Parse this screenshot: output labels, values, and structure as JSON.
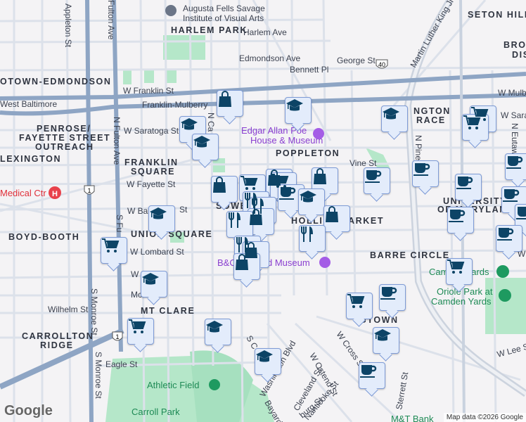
{
  "map": {
    "attribution": "Map data ©2026 Google",
    "logo": "Google",
    "neighborhoods": [
      "HARLEM PARK",
      "SETON HILL",
      "BROM",
      "DIS",
      "OTOWN-EDMONDSON",
      "PENROSE/",
      "FAYETTE STREET",
      "OUTREACH",
      "LEXINGTON",
      "FRANKLIN",
      "SQUARE",
      "POPPLETON",
      "NGTON",
      "RACE",
      "SOWE",
      "UNIVERSITY",
      "OF MARYLAN",
      "UNION SQUARE",
      "BOYD-BOOTH",
      "HOLLI",
      "ARKET",
      "BARRE CIRCLE",
      "MT CLARE",
      "CARROLLTON",
      "RIDGE",
      "GTOWN"
    ],
    "streets": [
      "Appleton St",
      "Fulton Ave",
      "Harlem Ave",
      "Edmondson Ave",
      "Bennett Pl",
      "George St",
      "Martin Luther King Jr",
      "W Franklin St",
      "Franklin-Mulberry",
      "West Baltimore",
      "W Mulb",
      "W Sarat",
      "W Saratoga St",
      "N Fulton Ave",
      "N Ca",
      "Vine St",
      "W Fayette St",
      "N Pine St",
      "N Eutaw St",
      "W Ba",
      "St",
      "W Lombard St",
      "S Fu",
      "W P",
      "Mcl",
      "Wilhelm St",
      "S Monroe St",
      "S Monroe St",
      "Eagle St",
      "S C",
      "Washington Blvd",
      "W Ostend St",
      "W Cross St",
      "Cleveland St",
      "Nanticoke St",
      "Sterrett St",
      "W Lee St",
      "Bayard",
      "burg St",
      "W Pr"
    ],
    "pois": [
      {
        "name_line1": "Augusta Fells Savage",
        "name_line2": "Institute of Visual Arts",
        "icon": "school-pin-icon"
      },
      {
        "name_line1": "Edgar Allan Poe",
        "name_line2": "House & Museum",
        "icon": "museum-pin-icon"
      },
      {
        "name_line1": "Medical Ctr",
        "icon": "hospital-icon"
      },
      {
        "name_line1": "B&O",
        "name_line2": "d Museum",
        "icon": "museum-pin-icon"
      },
      {
        "name_line1": "Camden Yards",
        "icon": "stadium-icon"
      },
      {
        "name_line1": "Oriole Park at",
        "name_line2": "Camden Yards",
        "icon": "stadium-icon"
      },
      {
        "name_line1": "Athletic Field",
        "icon": "park-pin-icon"
      },
      {
        "name_line1": "Carroll Park"
      },
      {
        "name_line1": "M&T Bank"
      }
    ],
    "shields": [
      "1",
      "40",
      "1"
    ],
    "markers": [
      "shopping",
      "school",
      "school",
      "school",
      "school",
      "grocery",
      "grocery",
      "shopping",
      "shopping",
      "grocery",
      "shopping",
      "grocery",
      "coffee",
      "school",
      "restaurant",
      "restaurant",
      "shopping",
      "restaurant",
      "shopping",
      "school",
      "coffee",
      "coffee",
      "coffee",
      "coffee",
      "coffee",
      "coffee",
      "coffee",
      "coffee",
      "grocery",
      "restaurant",
      "restaurant",
      "shopping",
      "shopping",
      "school",
      "grocery",
      "grocery",
      "coffee",
      "grocery",
      "school",
      "school",
      "school",
      "coffee"
    ],
    "colors": {
      "marker_fill": "#e3ecfb",
      "marker_border": "#7e9bd6",
      "icon": "#0d4466",
      "highway": "#8ea5c4",
      "park": "#b3e6c8"
    }
  }
}
